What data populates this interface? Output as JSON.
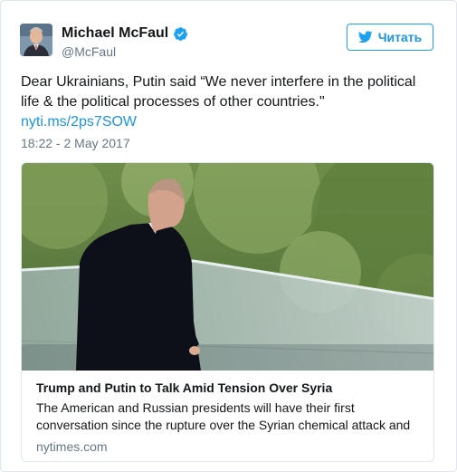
{
  "author": {
    "display_name": "Michael McFaul",
    "handle": "@McFaul",
    "verified": true
  },
  "follow_button": {
    "label": "Читать",
    "icon": "twitter-bird-icon"
  },
  "tweet": {
    "text": "Dear Ukrainians, Putin said “We never interfere in the political life & the political processes of other countries.\"",
    "link": "nyti.ms/2ps7SOW",
    "timestamp": "18:22 - 2 May 2017"
  },
  "card": {
    "title": "Trump and Putin to Talk Amid Tension Over Syria",
    "description": "The American and Russian presidents will have their first conversation since the rupture over the Syrian chemical attack and",
    "domain": "nytimes.com"
  },
  "colors": {
    "accent": "#1da1f2",
    "link": "#1b95e0",
    "muted": "#657786",
    "border": "#e1e8ed"
  }
}
